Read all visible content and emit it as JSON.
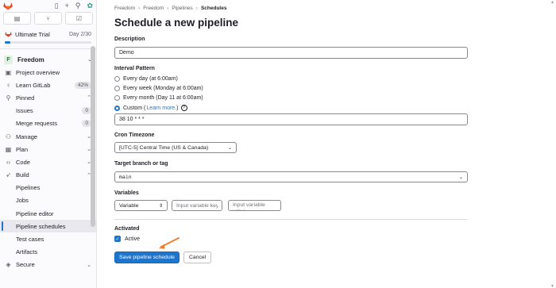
{
  "sidebar": {
    "top_counts": [
      {
        "icon": "issues-icon"
      },
      {
        "icon": "merge-request-icon"
      },
      {
        "icon": "todo-icon"
      }
    ],
    "trial": {
      "label": "Ultimate Trial",
      "day": "Day 2/30",
      "progress": 0.067
    },
    "project": {
      "initial": "F",
      "name": "Freedom"
    },
    "items": [
      {
        "label": "Project overview",
        "icon": "project-icon"
      },
      {
        "label": "Learn GitLab",
        "icon": "bulb-icon",
        "badge": "42%"
      },
      {
        "label": "Pinned",
        "icon": "pin-icon",
        "chev": "^"
      },
      {
        "label": "Issues",
        "sub": true,
        "badge": "0"
      },
      {
        "label": "Merge requests",
        "sub": true,
        "badge": "0"
      },
      {
        "label": "Manage",
        "icon": "users-icon",
        "chev": "v"
      },
      {
        "label": "Plan",
        "icon": "plan-icon",
        "chev": "v"
      },
      {
        "label": "Code",
        "icon": "code-icon",
        "chev": "v"
      },
      {
        "label": "Build",
        "icon": "rocket-icon",
        "chev": "^"
      },
      {
        "label": "Pipelines",
        "sub": true
      },
      {
        "label": "Jobs",
        "sub": true
      },
      {
        "label": "Pipeline editor",
        "sub": true
      },
      {
        "label": "Pipeline schedules",
        "sub": true,
        "active": true
      },
      {
        "label": "Test cases",
        "sub": true
      },
      {
        "label": "Artifacts",
        "sub": true
      },
      {
        "label": "Secure",
        "icon": "shield-icon",
        "chev": "v"
      }
    ]
  },
  "breadcrumb": [
    "Freedom",
    "Freedom",
    "Pipelines",
    "Schedules"
  ],
  "page_title": "Schedule a new pipeline",
  "form": {
    "description_label": "Description",
    "description_value": "Demo",
    "interval_label": "Interval Pattern",
    "interval_options": [
      {
        "label": "Every day (at 6:00am)",
        "checked": false
      },
      {
        "label": "Every week (Monday at 6:00am)",
        "checked": false
      },
      {
        "label": "Every month (Day 11 at 6:00am)",
        "checked": false
      },
      {
        "label": "Custom (",
        "link": "Learn more.",
        "after": ")",
        "checked": true
      }
    ],
    "cron_value": "38 10 * * *",
    "timezone_label": "Cron Timezone",
    "timezone_value": "[UTC-5] Central Time (US & Canada)",
    "branch_label": "Target branch or tag",
    "branch_value": "main",
    "variables_label": "Variables",
    "variable_type": "Variable",
    "variable_key_placeholder": "Input variable key",
    "variable_value_placeholder": "Input variable value",
    "activated_label": "Activated",
    "active_label": "Active",
    "save_label": "Save pipeline schedule",
    "cancel_label": "Cancel"
  },
  "colors": {
    "accent": "#1f75cb",
    "annotation_arrow": "#f07e2f"
  }
}
